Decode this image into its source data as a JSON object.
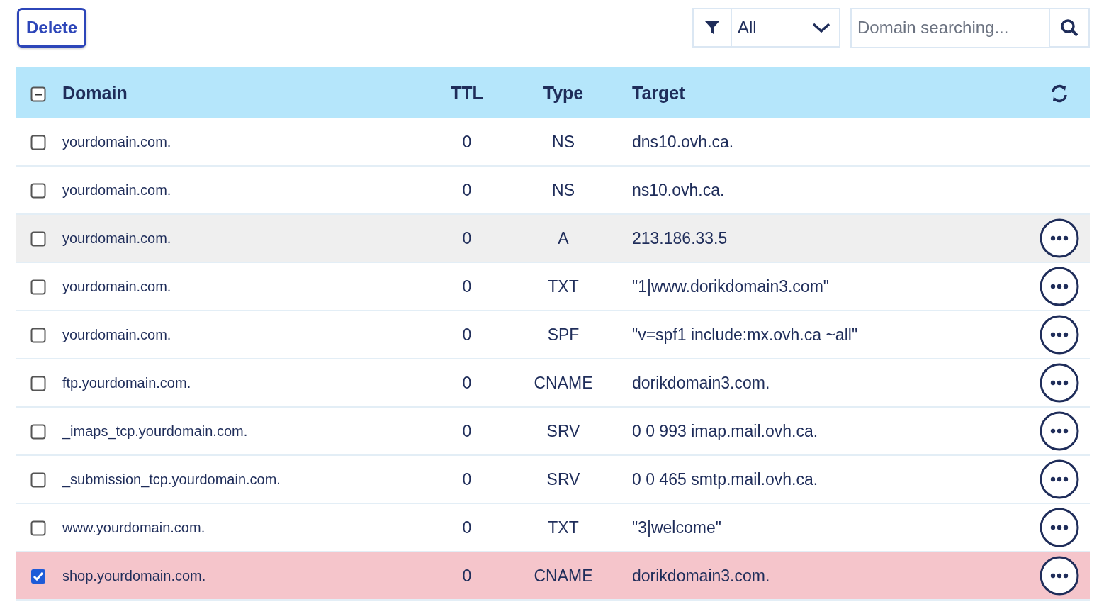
{
  "toolbar": {
    "delete_button": "Delete",
    "filter": {
      "value": "All"
    },
    "search": {
      "placeholder": "Domain searching..."
    }
  },
  "table": {
    "columns": [
      {
        "label": "Domain"
      },
      {
        "label": "TTL"
      },
      {
        "label": "Type"
      },
      {
        "label": "Target"
      }
    ],
    "select_all": {
      "checked": false,
      "partial": true
    },
    "rows": [
      {
        "domain": "yourdomain.com.",
        "ttl": "0",
        "type": "NS",
        "target": "dns10.ovh.ca.",
        "checked": false,
        "hovered": false,
        "actions": false
      },
      {
        "domain": "yourdomain.com.",
        "ttl": "0",
        "type": "NS",
        "target": "ns10.ovh.ca.",
        "checked": false,
        "hovered": false,
        "actions": false
      },
      {
        "domain": "yourdomain.com.",
        "ttl": "0",
        "type": "A",
        "target": "213.186.33.5",
        "checked": false,
        "hovered": true,
        "actions": true
      },
      {
        "domain": "yourdomain.com.",
        "ttl": "0",
        "type": "TXT",
        "target": "\"1|www.dorikdomain3.com\"",
        "checked": false,
        "hovered": false,
        "actions": true
      },
      {
        "domain": "yourdomain.com.",
        "ttl": "0",
        "type": "SPF",
        "target": "\"v=spf1 include:mx.ovh.ca ~all\"",
        "checked": false,
        "hovered": false,
        "actions": true
      },
      {
        "domain": "ftp.yourdomain.com.",
        "ttl": "0",
        "type": "CNAME",
        "target": "dorikdomain3.com.",
        "checked": false,
        "hovered": false,
        "actions": true
      },
      {
        "domain": "_imaps_tcp.yourdomain.com.",
        "ttl": "0",
        "type": "SRV",
        "target": "0 0 993 imap.mail.ovh.ca.",
        "checked": false,
        "hovered": false,
        "actions": true
      },
      {
        "domain": "_submission_tcp.yourdomain.com.",
        "ttl": "0",
        "type": "SRV",
        "target": "0 0 465 smtp.mail.ovh.ca.",
        "checked": false,
        "hovered": false,
        "actions": true
      },
      {
        "domain": "www.yourdomain.com.",
        "ttl": "0",
        "type": "TXT",
        "target": "\"3|welcome\"",
        "checked": false,
        "hovered": false,
        "actions": true
      },
      {
        "domain": "shop.yourdomain.com.",
        "ttl": "0",
        "type": "CNAME",
        "target": "dorikdomain3.com.",
        "checked": true,
        "hovered": false,
        "actions": true
      }
    ]
  }
}
